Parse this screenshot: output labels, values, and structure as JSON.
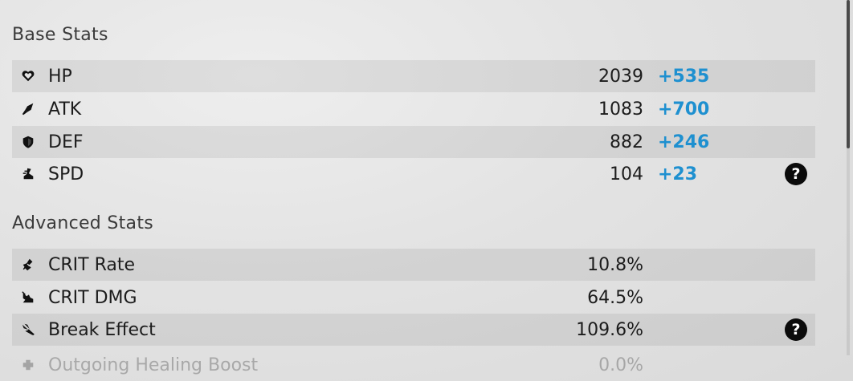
{
  "base_stats": {
    "title": "Base Stats",
    "rows": [
      {
        "label": "HP",
        "value": "2039",
        "bonus": "+535",
        "icon": "heart-icon"
      },
      {
        "label": "ATK",
        "value": "1083",
        "bonus": "+700",
        "icon": "sword-icon"
      },
      {
        "label": "DEF",
        "value": "882",
        "bonus": "+246",
        "icon": "shield-icon"
      },
      {
        "label": "SPD",
        "value": "104",
        "bonus": "+23",
        "icon": "boot-icon",
        "help": "?"
      }
    ]
  },
  "advanced_stats": {
    "title": "Advanced Stats",
    "rows": [
      {
        "label": "CRIT Rate",
        "value": "10.8%",
        "icon": "crit-rate-icon"
      },
      {
        "label": "CRIT DMG",
        "value": "64.5%",
        "icon": "crit-dmg-icon"
      },
      {
        "label": "Break Effect",
        "value": "109.6%",
        "icon": "break-effect-icon",
        "help": "?"
      },
      {
        "label": "Outgoing Healing Boost",
        "value": "0.0%",
        "icon": "healing-icon"
      }
    ]
  }
}
